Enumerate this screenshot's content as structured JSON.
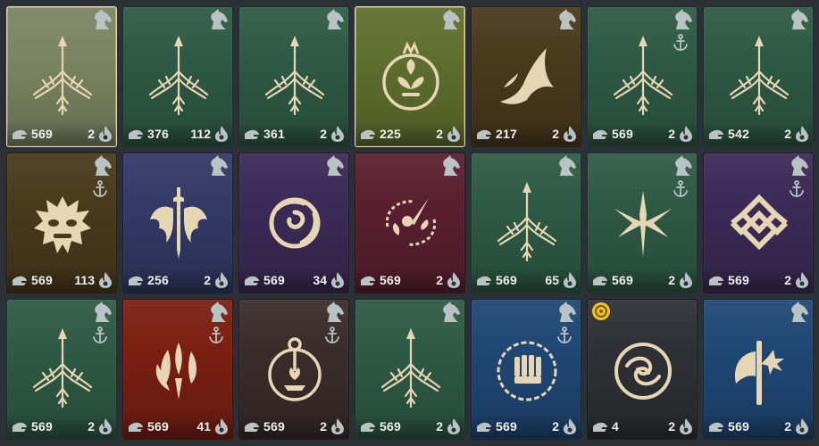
{
  "colors": {
    "emblem": "#e6d6b4",
    "corner_icon": "#b9c3c4",
    "text": "#eef0ee",
    "selected_border": "#e8d8a2",
    "coin": "#f2c32e"
  },
  "cards": [
    {
      "bg": "#7b8463",
      "emblem": "bow-emblem",
      "badge": "horse-icon",
      "anchor": false,
      "power": "569",
      "level": "2",
      "selected": true
    },
    {
      "bg": "#2e5a45",
      "emblem": "bow-emblem",
      "badge": "horse-icon",
      "anchor": false,
      "power": "376",
      "level": "112",
      "selected": false
    },
    {
      "bg": "#2e5a45",
      "emblem": "bow-emblem",
      "badge": "horse-icon",
      "anchor": false,
      "power": "361",
      "level": "2",
      "selected": false
    },
    {
      "bg": "#5f6f2e",
      "emblem": "pomegranate-emblem",
      "badge": "horse-icon",
      "anchor": false,
      "power": "225",
      "level": "2",
      "selected": true
    },
    {
      "bg": "#4a3a1c",
      "emblem": "wizard-hat-emblem",
      "badge": "horse-icon",
      "anchor": false,
      "power": "217",
      "level": "2",
      "selected": false
    },
    {
      "bg": "#2e5a45",
      "emblem": "bow-emblem",
      "badge": "horse-icon",
      "anchor": true,
      "power": "569",
      "level": "2",
      "selected": false
    },
    {
      "bg": "#2e5a45",
      "emblem": "bow-emblem",
      "badge": "horse-icon",
      "anchor": false,
      "power": "542",
      "level": "2",
      "selected": false
    },
    {
      "bg": "#4a3a1c",
      "emblem": "demon-mask-emblem",
      "badge": "horse-icon",
      "anchor": true,
      "power": "569",
      "level": "113",
      "selected": false
    },
    {
      "bg": "#323a66",
      "emblem": "sword-wings-emblem",
      "badge": "horse-icon",
      "anchor": false,
      "power": "256",
      "level": "2",
      "selected": false
    },
    {
      "bg": "#3c2a57",
      "emblem": "rose-emblem",
      "badge": "horse-icon",
      "anchor": false,
      "power": "569",
      "level": "34",
      "selected": false
    },
    {
      "bg": "#5a1f31",
      "emblem": "flower-vine-emblem",
      "badge": "horse-icon",
      "anchor": false,
      "power": "569",
      "level": "2",
      "selected": false
    },
    {
      "bg": "#2e5a45",
      "emblem": "bow-emblem",
      "badge": "horse-icon",
      "anchor": false,
      "power": "569",
      "level": "65",
      "selected": false
    },
    {
      "bg": "#2e5a45",
      "emblem": "crossed-blades-emblem",
      "badge": "horse-icon",
      "anchor": true,
      "power": "569",
      "level": "2",
      "selected": false
    },
    {
      "bg": "#3c2a57",
      "emblem": "knot-emblem",
      "badge": "horse-icon",
      "anchor": true,
      "power": "569",
      "level": "2",
      "selected": false
    },
    {
      "bg": "#2e5a45",
      "emblem": "bow-emblem",
      "badge": "horse-icon",
      "anchor": true,
      "power": "569",
      "level": "2",
      "selected": false
    },
    {
      "bg": "#7a1f12",
      "emblem": "flame-emblem",
      "badge": "horse-icon",
      "anchor": true,
      "power": "569",
      "level": "41",
      "selected": false
    },
    {
      "bg": "#3a2c2a",
      "emblem": "ring-sprout-emblem",
      "badge": "horse-icon",
      "anchor": true,
      "power": "569",
      "level": "2",
      "selected": false
    },
    {
      "bg": "#2e5a45",
      "emblem": "bow-emblem",
      "badge": "horse-icon",
      "anchor": false,
      "power": "569",
      "level": "2",
      "selected": false
    },
    {
      "bg": "#1f4774",
      "emblem": "fist-circle-emblem",
      "badge": "horse-icon",
      "anchor": true,
      "power": "569",
      "level": "2",
      "selected": false
    },
    {
      "bg": "#2f3035",
      "emblem": "swirl-orb-emblem",
      "badge": "coin-icon",
      "anchor": false,
      "power": "4",
      "level": "2",
      "selected": false
    },
    {
      "bg": "#1f4774",
      "emblem": "axe-star-emblem",
      "badge": "horse-icon",
      "anchor": false,
      "power": "569",
      "level": "2",
      "selected": false
    }
  ]
}
